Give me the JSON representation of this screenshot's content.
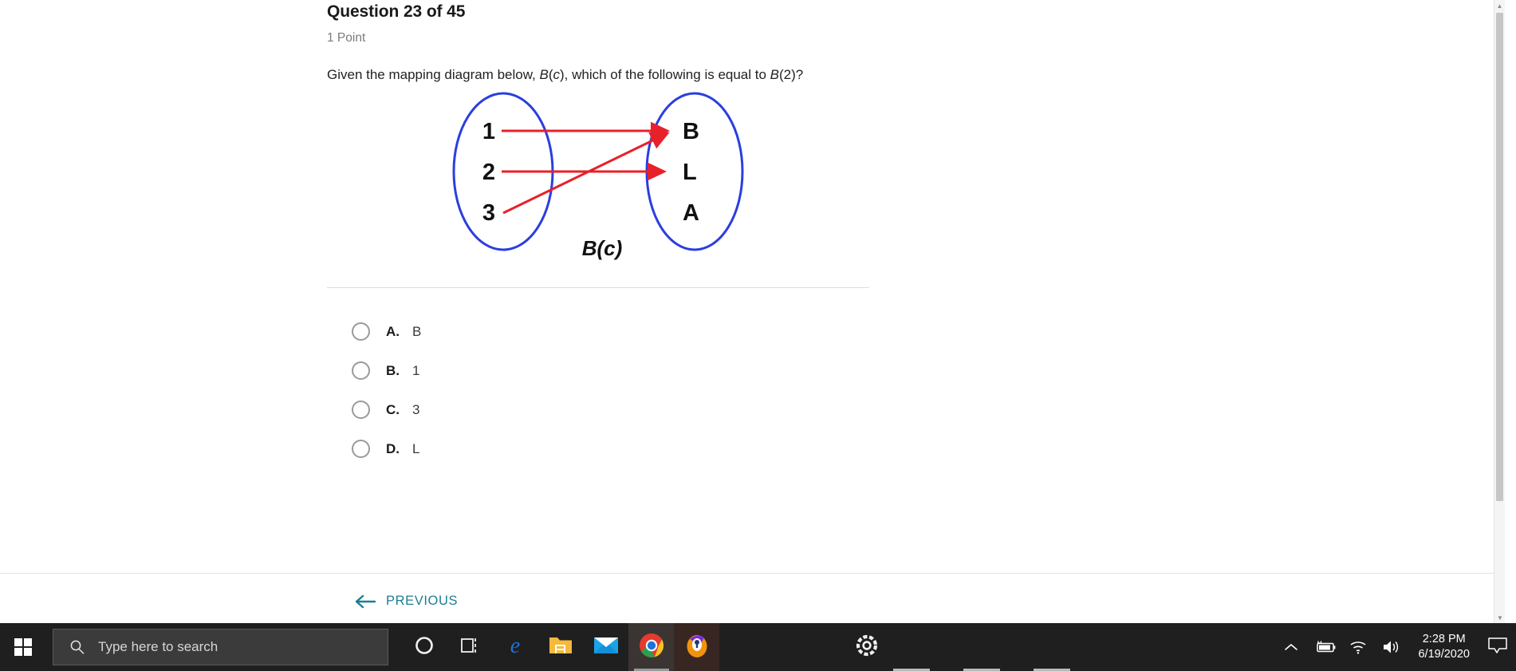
{
  "quiz": {
    "question_title": "Question 23 of 45",
    "points": "1 Point",
    "question_text_1": "Given the mapping diagram below, ",
    "question_italic_1": "B",
    "question_text_2": "(",
    "question_italic_2": "c",
    "question_text_3": "), which of the following is equal to ",
    "question_italic_3": "B",
    "question_text_4": "(2)?",
    "diagram": {
      "caption": "B(c)",
      "domain_label": "domain-set",
      "range_label": "range-set",
      "domain_items": [
        "1",
        "2",
        "3"
      ],
      "range_items": [
        "B",
        "L",
        "A"
      ],
      "mappings": [
        {
          "from": "1",
          "to": "B"
        },
        {
          "from": "2",
          "to": "L"
        },
        {
          "from": "3",
          "to": "B"
        }
      ],
      "ellipse_color": "#2a3ee0",
      "arrow_color": "#e8202a"
    },
    "options": [
      {
        "letter": "A.",
        "value": "B"
      },
      {
        "letter": "B.",
        "value": "1"
      },
      {
        "letter": "C.",
        "value": "3"
      },
      {
        "letter": "D.",
        "value": "L"
      }
    ],
    "previous_label": "PREVIOUS",
    "accent_color": "#1a7f93"
  },
  "taskbar": {
    "start_name": "windows-start",
    "search_placeholder": "Type here to search",
    "items": [
      {
        "name": "cortana-icon"
      },
      {
        "name": "task-view-icon"
      },
      {
        "name": "microsoft-edge-icon"
      },
      {
        "name": "file-explorer-icon"
      },
      {
        "name": "mail-icon"
      },
      {
        "name": "google-chrome-icon"
      },
      {
        "name": "firefox-icon"
      },
      {
        "name": "settings-gear-icon"
      }
    ],
    "tray": [
      {
        "name": "show-hidden-icons-chevron"
      },
      {
        "name": "battery-charging-icon"
      },
      {
        "name": "wifi-icon"
      },
      {
        "name": "volume-icon"
      }
    ],
    "clock_time": "2:28 PM",
    "clock_date": "6/19/2020",
    "action_center_name": "action-center-icon"
  }
}
